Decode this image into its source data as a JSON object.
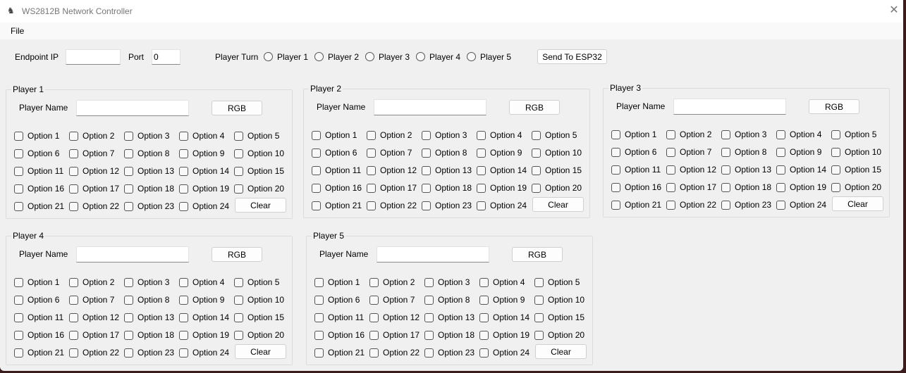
{
  "window": {
    "title": "WS2812B Network Controller",
    "close_icon": "close-icon"
  },
  "menu": {
    "file": "File"
  },
  "toolbar": {
    "endpoint_ip_label": "Endpoint IP",
    "endpoint_ip_value": "",
    "port_label": "Port",
    "port_value": "0",
    "player_turn_label": "Player Turn",
    "turn_options": [
      "Player 1",
      "Player 2",
      "Player 3",
      "Player 4",
      "Player 5"
    ],
    "send_button": "Send To ESP32"
  },
  "players": [
    {
      "title": "Player 1",
      "name_label": "Player Name",
      "name_value": "",
      "rgb": "RGB",
      "clear": "Clear"
    },
    {
      "title": "Player 2",
      "name_label": "Player Name",
      "name_value": "",
      "rgb": "RGB",
      "clear": "Clear"
    },
    {
      "title": "Player 3",
      "name_label": "Player Name",
      "name_value": "",
      "rgb": "RGB",
      "clear": "Clear"
    },
    {
      "title": "Player 4",
      "name_label": "Player Name",
      "name_value": "",
      "rgb": "RGB",
      "clear": "Clear"
    },
    {
      "title": "Player 5",
      "name_label": "Player Name",
      "name_value": "",
      "rgb": "RGB",
      "clear": "Clear"
    }
  ],
  "options": [
    "Option 1",
    "Option 2",
    "Option 3",
    "Option 4",
    "Option 5",
    "Option 6",
    "Option 7",
    "Option 8",
    "Option 9",
    "Option 10",
    "Option 11",
    "Option 12",
    "Option 13",
    "Option 14",
    "Option 15",
    "Option 16",
    "Option 17",
    "Option 18",
    "Option 19",
    "Option 20",
    "Option 21",
    "Option 22",
    "Option 23",
    "Option 24"
  ]
}
